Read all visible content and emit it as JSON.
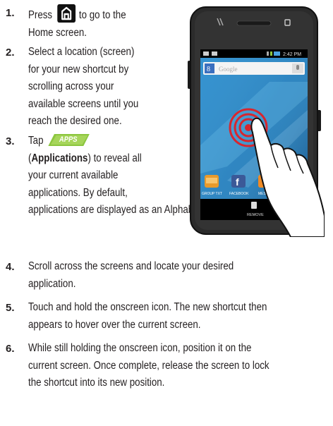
{
  "steps": [
    {
      "number": "1.",
      "line1_before": "Press",
      "line1_after": "to go to the",
      "line2": "Home screen.",
      "icon": "home-key-icon"
    },
    {
      "number": "2.",
      "lines": [
        "Select a location (screen)",
        "for your new shortcut by",
        "scrolling across your",
        "available screens until you",
        "reach the desired one."
      ]
    },
    {
      "number": "3.",
      "line1_before": "Tap",
      "apps_label": "APPS",
      "icon": "apps-tab-icon",
      "line2_bold": "Applications",
      "line2_rest": ") to reveal all",
      "line3": "your current available",
      "line4": "applications. By default,",
      "line5": "applications are displayed as an Alphabetical grid."
    },
    {
      "number": "4.",
      "lines": [
        "Scroll across the screens and locate your desired",
        "application."
      ]
    },
    {
      "number": "5.",
      "lines": [
        "Touch and hold the onscreen icon. The new shortcut then",
        "appears to hover over the current screen."
      ]
    },
    {
      "number": "6.",
      "lines": [
        "While still holding the onscreen icon, position it on the",
        "current screen. Once complete, release the screen to lock",
        "the shortcut into its new position."
      ]
    }
  ],
  "phone": {
    "time": "2:42 PM",
    "search_placeholder": "Google",
    "apps": [
      "GROUP TXT",
      "FACEBOOK",
      "MES"
    ],
    "remove_label": "REMOVE",
    "colors": {
      "body": "#2b2b2b",
      "screen_bg": "#1c6fb0",
      "target": "#d8262e",
      "apps_tab": "#8cc63f"
    }
  }
}
